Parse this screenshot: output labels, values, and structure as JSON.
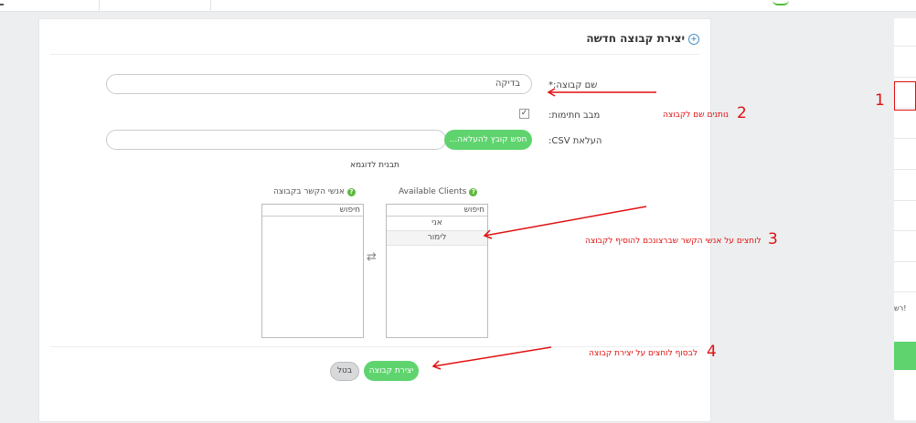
{
  "colors": {
    "accent_green": "#5fd46e",
    "annotation_red": "#e01010",
    "help_green": "#5fb83e",
    "info_blue": "#4a90c2"
  },
  "panel": {
    "title": "יצירת קבוצה חדשה",
    "info_icon": "info-circle-icon"
  },
  "form": {
    "group_name_label": "שם קבוצה:*",
    "group_name_value": "בדיקה",
    "subscriptions_label": "מבב חתימות:",
    "subscriptions_checked": true,
    "csv_label": "העלאת CSV:",
    "csv_button": "חפש קובץ להעלאה...",
    "sample_link": "תבנית לדוגמא"
  },
  "lists": {
    "available_title": "Available Clients",
    "group_title": "אנשי הקשר בקבוצה",
    "search_placeholder": "חיפוש",
    "available_items": [
      "אני",
      "לימור"
    ],
    "swap_icon": "swap-arrows-icon"
  },
  "actions": {
    "create": "יצירת קבוצה",
    "cancel": "בטל"
  },
  "right_panel": {
    "text": "רש!"
  },
  "annotations": {
    "n1": "1",
    "n2": "2",
    "t2": "נותנים שם לקבוצה",
    "n3": "3",
    "t3": "לוחצים על אנשי הקשר שברצונכם להוסיף לקבוצה",
    "n4": "4",
    "t4": "לבסוף לוחצים על יצירת קבוצה"
  }
}
